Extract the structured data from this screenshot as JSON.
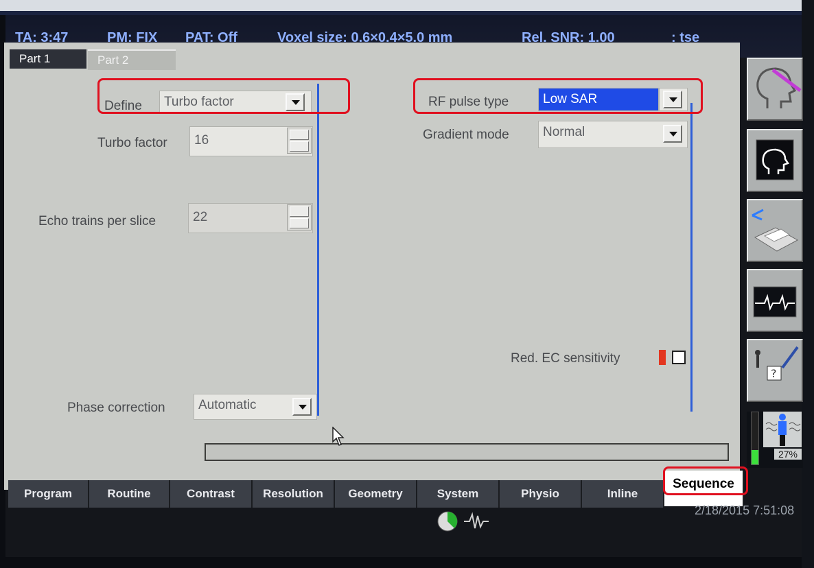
{
  "status": {
    "ta": "TA: 3:47",
    "pm": "PM: FIX",
    "pat": "PAT: Off",
    "voxel": "Voxel size: 0.6×0.4×5.0 mm",
    "snr": "Rel. SNR: 1.00",
    "seq": ": tse"
  },
  "part_tabs": [
    "Part 1",
    "Part 2"
  ],
  "left": {
    "define_label": "Define",
    "define_value": "Turbo factor",
    "turbo_label": "Turbo factor",
    "turbo_value": "16",
    "echo_label": "Echo trains per slice",
    "echo_value": "22",
    "phase_label": "Phase correction",
    "phase_value": "Automatic"
  },
  "right": {
    "rf_label": "RF pulse type",
    "rf_value": "Low SAR",
    "grad_label": "Gradient mode",
    "grad_value": "Normal",
    "redec_label": "Red. EC sensitivity"
  },
  "bottom_tabs": [
    "Program",
    "Routine",
    "Contrast",
    "Resolution",
    "Geometry",
    "System",
    "Physio",
    "Inline",
    "Sequence"
  ],
  "active_tab": "Sequence",
  "sar_percent": "27%",
  "sar_fraction": 0.27,
  "datetime": "2/18/2015 7:51:08",
  "colors": {
    "status_text": "#8fb0ff",
    "highlight": "#1f4be6",
    "annotation": "#e0101f"
  },
  "side_icons": [
    "head-localizer-icon",
    "head-view-icon",
    "patient-table-icon",
    "ecg-monitor-icon",
    "patient-help-icon",
    "sar-level-icon"
  ]
}
